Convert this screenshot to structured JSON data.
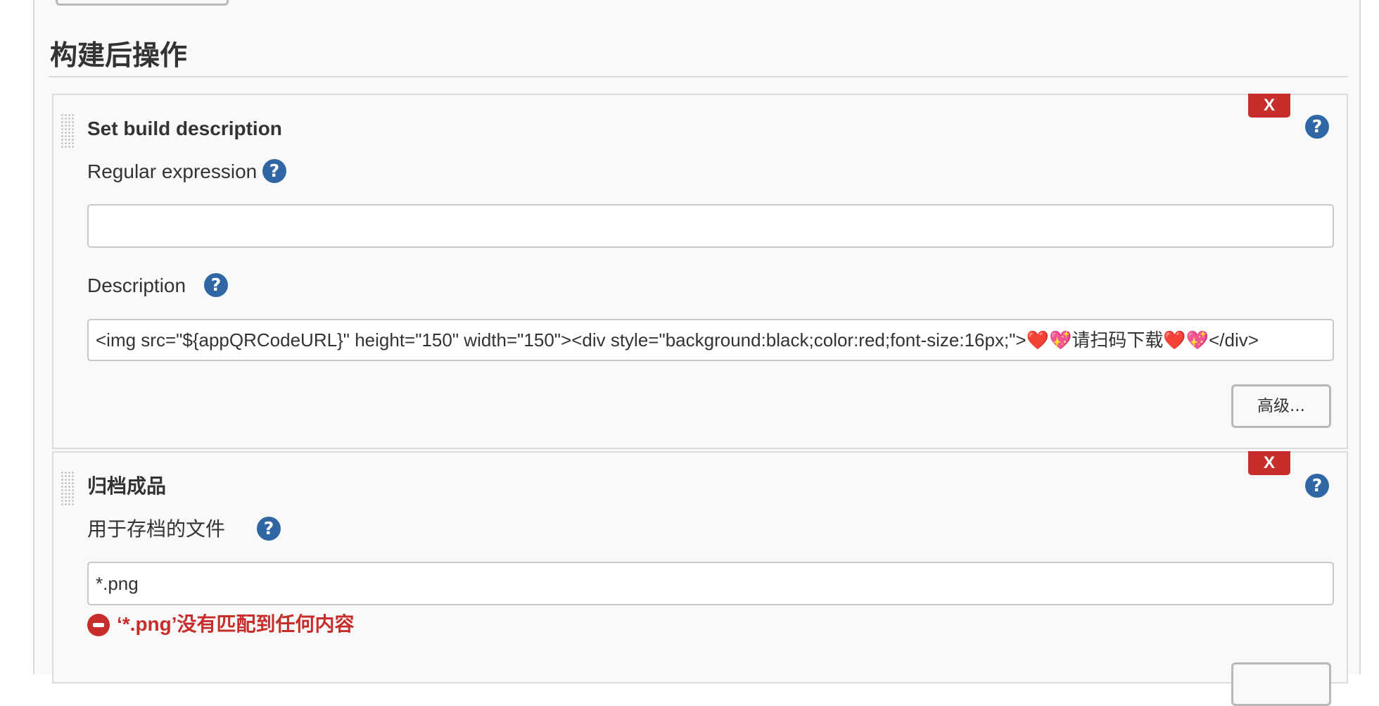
{
  "section": {
    "title": "构建后操作"
  },
  "steps": [
    {
      "title": "Set build description",
      "delete_label": "X",
      "help_label": "?",
      "fields": [
        {
          "label": "Regular expression",
          "help_label": "?",
          "value": ""
        },
        {
          "label": "Description",
          "help_label": "?",
          "value": "<img src=\"${appQRCodeURL}\" height=\"150\" width=\"150\"><div style=\"background:black;color:red;font-size:16px;\">❤️💖请扫码下载❤️💖</div>"
        }
      ],
      "advanced_label": "高级..."
    },
    {
      "title": "归档成品",
      "delete_label": "X",
      "help_label": "?",
      "fields": [
        {
          "label": "用于存档的文件",
          "help_label": "?",
          "value": "*.png"
        }
      ],
      "error_message": "‘*.png’没有匹配到任何内容"
    }
  ],
  "colors": {
    "delete_button": "#c72e2b",
    "help_icon": "#2f66a3",
    "error_text": "#c72e2b",
    "panel_background": "#f9f9f9"
  },
  "icons": {
    "help": "question-circle-icon",
    "error": "no-entry-icon",
    "drag": "drag-handle-dots"
  }
}
